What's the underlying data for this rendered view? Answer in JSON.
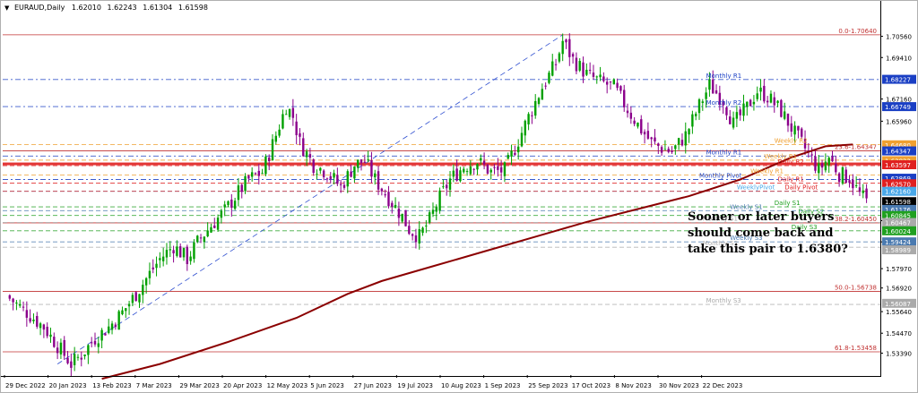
{
  "header": {
    "symbol": "EURAUD,Daily",
    "quotes": [
      "1.62010",
      "1.62243",
      "1.61304",
      "1.61598"
    ]
  },
  "annotation": {
    "lines": [
      "Sooner or later buyers",
      "should come back and",
      "take this pair to 1.6380?"
    ]
  },
  "colors": {
    "bull": "#00a000",
    "bear": "#8b008b",
    "ma": "#8b0000",
    "price_tag": "#1e3bbf"
  },
  "chart_data": {
    "type": "candlestick",
    "y_range": [
      1.522,
      1.718
    ],
    "y_ticks": [
      "1.70560",
      "1.69410",
      "1.67160",
      "1.65960",
      "1.60570",
      "1.59420",
      "1.57970",
      "1.56920",
      "1.55640",
      "1.54470",
      "1.53390"
    ],
    "x_ticks": [
      "29 Dec 2022",
      "20 Jan 2023",
      "13 Feb 2023",
      "7 Mar 2023",
      "29 Mar 2023",
      "20 Apr 2023",
      "12 May 2023",
      "5 Jun 2023",
      "27 Jun 2023",
      "19 Jul 2023",
      "10 Aug 2023",
      "1 Sep 2023",
      "25 Sep 2023",
      "17 Oct 2023",
      "8 Nov 2023",
      "30 Nov 2023",
      "22 Dec 2023"
    ],
    "close_path": [
      [
        0,
        1.565
      ],
      [
        6,
        1.556
      ],
      [
        11,
        1.548
      ],
      [
        15,
        1.538
      ],
      [
        19,
        1.528
      ],
      [
        22,
        1.533
      ],
      [
        26,
        1.542
      ],
      [
        30,
        1.548
      ],
      [
        34,
        1.556
      ],
      [
        38,
        1.566
      ],
      [
        42,
        1.577
      ],
      [
        45,
        1.585
      ],
      [
        49,
        1.592
      ],
      [
        53,
        1.585
      ],
      [
        56,
        1.594
      ],
      [
        60,
        1.603
      ],
      [
        64,
        1.611
      ],
      [
        68,
        1.621
      ],
      [
        71,
        1.628
      ],
      [
        75,
        1.632
      ],
      [
        79,
        1.652
      ],
      [
        82,
        1.668
      ],
      [
        84,
        1.662
      ],
      [
        86,
        1.648
      ],
      [
        90,
        1.636
      ],
      [
        94,
        1.632
      ],
      [
        98,
        1.624
      ],
      [
        102,
        1.636
      ],
      [
        105,
        1.638
      ],
      [
        108,
        1.628
      ],
      [
        112,
        1.618
      ],
      [
        116,
        1.608
      ],
      [
        118,
        1.601
      ],
      [
        121,
        1.597
      ],
      [
        124,
        1.606
      ],
      [
        127,
        1.618
      ],
      [
        130,
        1.628
      ],
      [
        134,
        1.635
      ],
      [
        138,
        1.638
      ],
      [
        142,
        1.632
      ],
      [
        146,
        1.633
      ],
      [
        149,
        1.645
      ],
      [
        153,
        1.662
      ],
      [
        157,
        1.678
      ],
      [
        161,
        1.691
      ],
      [
        163,
        1.703
      ],
      [
        166,
        1.693
      ],
      [
        170,
        1.685
      ],
      [
        174,
        1.681
      ],
      [
        178,
        1.678
      ],
      [
        182,
        1.666
      ],
      [
        186,
        1.655
      ],
      [
        189,
        1.648
      ],
      [
        192,
        1.645
      ],
      [
        195,
        1.643
      ],
      [
        199,
        1.652
      ],
      [
        203,
        1.668
      ],
      [
        206,
        1.679
      ],
      [
        210,
        1.671
      ],
      [
        213,
        1.658
      ],
      [
        217,
        1.667
      ],
      [
        220,
        1.676
      ],
      [
        223,
        1.673
      ],
      [
        227,
        1.665
      ],
      [
        231,
        1.653
      ],
      [
        235,
        1.642
      ],
      [
        238,
        1.633
      ],
      [
        241,
        1.64
      ],
      [
        244,
        1.631
      ],
      [
        247,
        1.629
      ],
      [
        250,
        1.62
      ],
      [
        252,
        1.616
      ]
    ],
    "moving_average_path": [
      [
        28,
        1.52
      ],
      [
        45,
        1.528
      ],
      [
        65,
        1.54
      ],
      [
        85,
        1.553
      ],
      [
        100,
        1.566
      ],
      [
        110,
        1.573
      ],
      [
        125,
        1.581
      ],
      [
        140,
        1.589
      ],
      [
        155,
        1.597
      ],
      [
        170,
        1.605
      ],
      [
        185,
        1.612
      ],
      [
        200,
        1.619
      ],
      [
        215,
        1.628
      ],
      [
        230,
        1.64
      ],
      [
        240,
        1.646
      ],
      [
        248,
        1.647
      ]
    ],
    "fibonacci_levels": [
      {
        "label": "0.0-1.70640",
        "value": 1.7064
      },
      {
        "label": "23.6-1.64347",
        "value": 1.6435
      },
      {
        "label": "38.2-1.60450",
        "value": 1.6045
      },
      {
        "label": "50.0-1.56738",
        "value": 1.5674
      },
      {
        "label": "61.8-1.53458",
        "value": 1.5346
      }
    ],
    "pivot_levels": [
      {
        "label": "Monthly R1",
        "value": 1.6822,
        "x": 205,
        "color": "#1a3fc4"
      },
      {
        "label": "Monthly R2",
        "value": 1.6675,
        "x": 205,
        "color": "#1a3fc4"
      },
      {
        "label": "Weekly R2",
        "value": 1.6469,
        "x": 225,
        "color": "#f0a030"
      },
      {
        "label": "Monthly R1",
        "value": 1.6407,
        "x": 205,
        "color": "#1a3fc4"
      },
      {
        "label": "Weekly R1",
        "value": 1.6385,
        "x": 222,
        "color": "#f0a030"
      },
      {
        "label": "Daily R2",
        "value": 1.6355,
        "x": 226,
        "color": "#e02020"
      },
      {
        "label": "Weekly R1",
        "value": 1.6304,
        "x": 218,
        "color": "#f0a030"
      },
      {
        "label": "Monthly Pivot",
        "value": 1.628,
        "x": 203,
        "color": "#1a3fc4"
      },
      {
        "label": "Daily R1",
        "value": 1.626,
        "x": 226,
        "color": "#e02020"
      },
      {
        "label": "WeeklyPivot",
        "value": 1.6216,
        "x": 214,
        "color": "#4aa8e8"
      },
      {
        "label": "Daily Pivot",
        "value": 1.6216,
        "x": 228,
        "color": "#e02020"
      },
      {
        "label": "Daily S1",
        "value": 1.6132,
        "x": 225,
        "color": "#20a020"
      },
      {
        "label": "Weekly S1",
        "value": 1.6111,
        "x": 212,
        "color": "#4a7ab0"
      },
      {
        "label": "Daily S2",
        "value": 1.6085,
        "x": 232,
        "color": "#20a020"
      },
      {
        "label": "Monthly S1",
        "value": 1.6047,
        "x": 204,
        "color": "#aaaaaa"
      },
      {
        "label": "Daily S3",
        "value": 1.6002,
        "x": 230,
        "color": "#20a020"
      },
      {
        "label": "Weekly S3",
        "value": 1.5942,
        "x": 212,
        "color": "#4a7ab0"
      },
      {
        "label": "Monthly S2",
        "value": 1.5913,
        "x": 204,
        "color": "#aaaaaa"
      },
      {
        "label": "Monthly S3",
        "value": 1.5603,
        "x": 205,
        "color": "#aaaaaa"
      }
    ],
    "price_tags": [
      {
        "label": "1.68227",
        "value": 1.6823,
        "bg": "#1a3fc4",
        "fg": "#ffffff"
      },
      {
        "label": "1.66749",
        "value": 1.6675,
        "bg": "#1a3fc4",
        "fg": "#ffffff"
      },
      {
        "label": "1.64680",
        "value": 1.6468,
        "bg": "#f0a030",
        "fg": "#ffffff"
      },
      {
        "label": "1.64347",
        "value": 1.6435,
        "bg": "#1a3fc4",
        "fg": "#ffffff"
      },
      {
        "label": "1.63822",
        "value": 1.6382,
        "bg": "#f0a030",
        "fg": "#ffffff"
      },
      {
        "label": "1.63597",
        "value": 1.636,
        "bg": "#e02020",
        "fg": "#ffffff"
      },
      {
        "label": "1.62869",
        "value": 1.6287,
        "bg": "#1a3fc4",
        "fg": "#ffffff"
      },
      {
        "label": "1.62570",
        "value": 1.6257,
        "bg": "#e02020",
        "fg": "#ffffff"
      },
      {
        "label": "1.62160",
        "value": 1.6216,
        "bg": "#4aa8e8",
        "fg": "#ffffff"
      },
      {
        "label": "1.61598",
        "value": 1.616,
        "bg": "#000000",
        "fg": "#ffffff"
      },
      {
        "label": "1.61176",
        "value": 1.6118,
        "bg": "#4a7ab0",
        "fg": "#ffffff"
      },
      {
        "label": "1.60845",
        "value": 1.6085,
        "bg": "#20a020",
        "fg": "#ffffff"
      },
      {
        "label": "1.60467",
        "value": 1.6047,
        "bg": "#aaaaaa",
        "fg": "#ffffff"
      },
      {
        "label": "1.60024",
        "value": 1.6002,
        "bg": "#20a020",
        "fg": "#ffffff"
      },
      {
        "label": "1.59424",
        "value": 1.5942,
        "bg": "#4a7ab0",
        "fg": "#ffffff"
      },
      {
        "label": "1.58989",
        "value": 1.5899,
        "bg": "#aaaaaa",
        "fg": "#ffffff"
      },
      {
        "label": "1.56087",
        "value": 1.5609,
        "bg": "#aaaaaa",
        "fg": "#ffffff"
      }
    ]
  }
}
